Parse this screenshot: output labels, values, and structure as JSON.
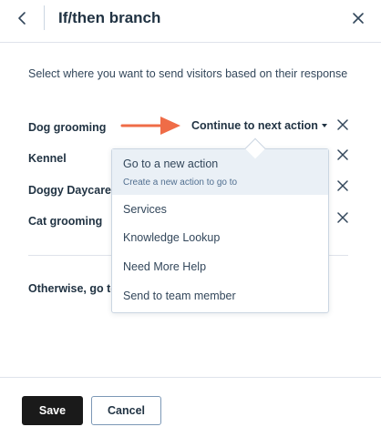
{
  "header": {
    "title": "If/then branch",
    "back_icon": "chevron-left-icon",
    "close_icon": "close-icon"
  },
  "instructions": "Select where you want to send visitors based on their response",
  "branches": [
    {
      "label": "Dog grooming",
      "action": "Continue to next action"
    },
    {
      "label": "Kennel"
    },
    {
      "label": "Doggy Daycare"
    },
    {
      "label": "Cat grooming"
    }
  ],
  "otherwise": {
    "label": "Otherwise, go to"
  },
  "dropdown": {
    "new_action": {
      "label": "Go to a new action",
      "description": "Create a new action to go to"
    },
    "options": [
      "Services",
      "Knowledge Lookup",
      "Need More Help",
      "Send to team member"
    ]
  },
  "footer": {
    "save_label": "Save",
    "cancel_label": "Cancel"
  },
  "colors": {
    "arrow": "#ef6c47",
    "highlight": "#eaf0f6",
    "primary_button": "#1a1a1a",
    "text": "#33475b"
  }
}
